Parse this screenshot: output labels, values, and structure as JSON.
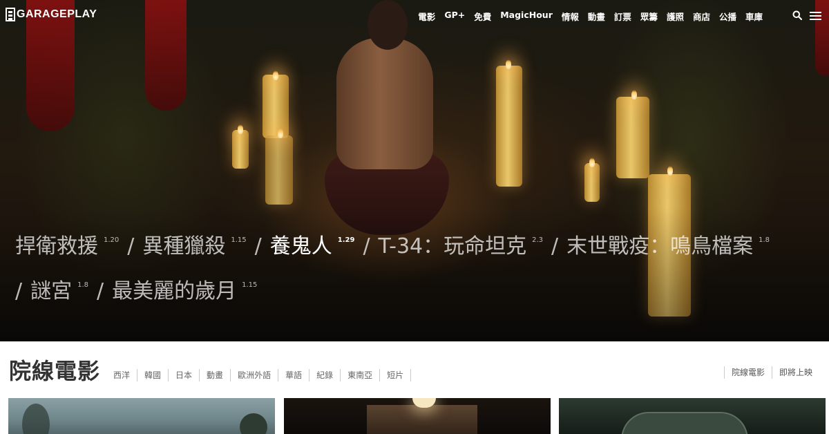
{
  "brand": {
    "logo_text": "GARAGEPLAY"
  },
  "nav": {
    "items": [
      "電影",
      "GP+",
      "免費",
      "MagicHour",
      "情報",
      "動畫",
      "訂票",
      "眾籌",
      "護照",
      "商店",
      "公播",
      "車庫"
    ],
    "search_icon": "search-icon",
    "menu_icon": "hamburger-menu-icon"
  },
  "hero": {
    "films": [
      {
        "title": "捍衛救援",
        "date": "1.20",
        "active": false
      },
      {
        "title": "異種獵殺",
        "date": "1.15",
        "active": false
      },
      {
        "title": "養鬼人",
        "date": "1.29",
        "active": true
      },
      {
        "title": "T-34：玩命坦克",
        "date": "2.3",
        "active": false
      },
      {
        "title": "末世戰疫：鳴鳥檔案",
        "date": "1.8",
        "active": false
      },
      {
        "title": "謎宮",
        "date": "1.8",
        "active": false
      },
      {
        "title": "最美麗的歲月",
        "date": "1.15",
        "active": false
      }
    ],
    "separator": "/"
  },
  "section": {
    "title": "院線電影",
    "categories": [
      "西洋",
      "韓國",
      "日本",
      "動畫",
      "歐洲外語",
      "華語",
      "紀錄",
      "東南亞",
      "短片"
    ],
    "tabs": [
      "院線電影",
      "即將上映"
    ]
  },
  "colors": {
    "accent": "#ffffff",
    "text_dark": "#333333",
    "muted": "#666666"
  }
}
